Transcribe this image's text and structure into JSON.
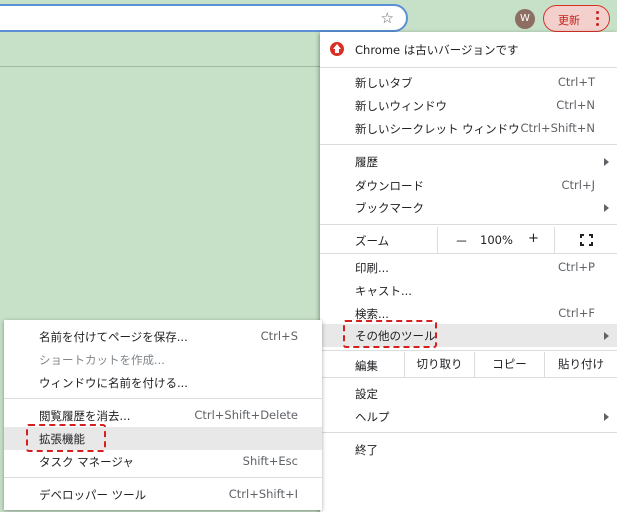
{
  "toolbar": {
    "avatar_initial": "W",
    "update_label": "更新",
    "star_glyph": "☆"
  },
  "menu": {
    "update_notice": "Chrome は古いバージョンです",
    "new_tab": "新しいタブ",
    "new_tab_sc": "Ctrl+T",
    "new_window": "新しいウィンドウ",
    "new_window_sc": "Ctrl+N",
    "incognito": "新しいシークレット ウィンドウ",
    "incognito_sc": "Ctrl+Shift+N",
    "history": "履歴",
    "downloads": "ダウンロード",
    "downloads_sc": "Ctrl+J",
    "bookmarks": "ブックマーク",
    "zoom_label": "ズーム",
    "zoom_minus": "－",
    "zoom_value": "100%",
    "zoom_plus": "+",
    "print": "印刷...",
    "print_sc": "Ctrl+P",
    "cast": "キャスト...",
    "find": "検索...",
    "find_sc": "Ctrl+F",
    "more_tools": "その他のツール",
    "edit_label": "編集",
    "cut": "切り取り",
    "copy": "コピー",
    "paste": "貼り付け",
    "settings": "設定",
    "help": "ヘルプ",
    "exit": "終了"
  },
  "submenu": {
    "save_page": "名前を付けてページを保存...",
    "save_page_sc": "Ctrl+S",
    "create_shortcut": "ショートカットを作成...",
    "name_window": "ウィンドウに名前を付ける...",
    "clear_data": "閲覧履歴を消去...",
    "clear_data_sc": "Ctrl+Shift+Delete",
    "extensions": "拡張機能",
    "task_manager": "タスク マネージャ",
    "task_manager_sc": "Shift+Esc",
    "dev_tools": "デベロッパー ツール",
    "dev_tools_sc": "Ctrl+Shift+I"
  },
  "colors": {
    "background": "#c7e0c8",
    "highlight_dash": "#d61f1f",
    "update_accent": "#d93025"
  }
}
